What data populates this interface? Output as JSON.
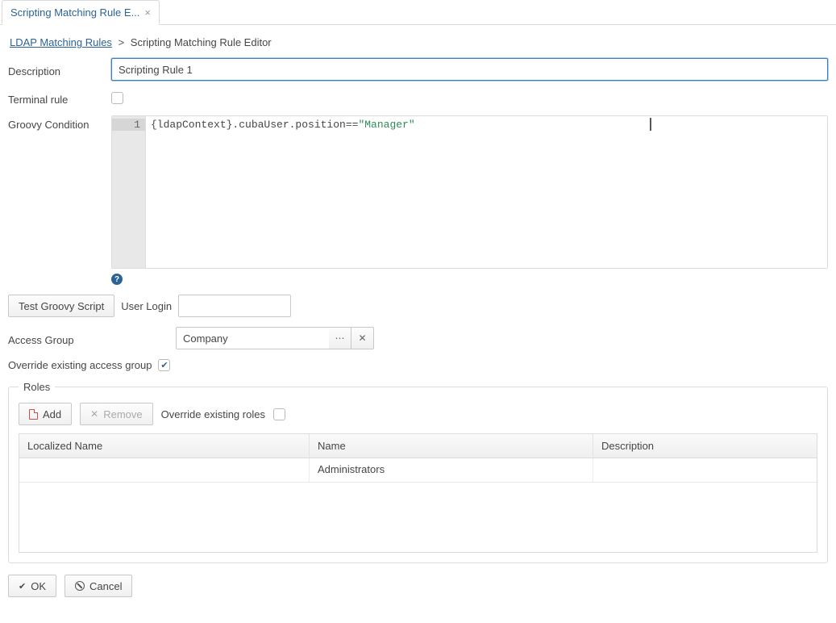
{
  "tab": {
    "title": "Scripting Matching Rule E..."
  },
  "breadcrumb": {
    "parent": "LDAP Matching Rules",
    "current": "Scripting Matching Rule Editor"
  },
  "labels": {
    "description": "Description",
    "terminal": "Terminal rule",
    "groovy": "Groovy Condition",
    "userLogin": "User Login",
    "accessGroup": "Access Group",
    "overrideAccess": "Override existing access group",
    "overrideRoles": "Override existing roles",
    "rolesLegend": "Roles"
  },
  "form": {
    "description": "Scripting Rule 1",
    "terminal": false,
    "code": {
      "lineNumber": "1",
      "plain": "{ldapContext}.cubaUser.position==",
      "string": "\"Manager\""
    },
    "userLogin": "",
    "accessGroup": "Company",
    "overrideAccess": true,
    "overrideRoles": false
  },
  "buttons": {
    "testGroovy": "Test Groovy Script",
    "add": "Add",
    "remove": "Remove",
    "ok": "OK",
    "cancel": "Cancel"
  },
  "rolesTable": {
    "headers": {
      "localized": "Localized Name",
      "name": "Name",
      "description": "Description"
    },
    "rows": [
      {
        "localized": "",
        "name": "Administrators",
        "description": ""
      }
    ]
  }
}
